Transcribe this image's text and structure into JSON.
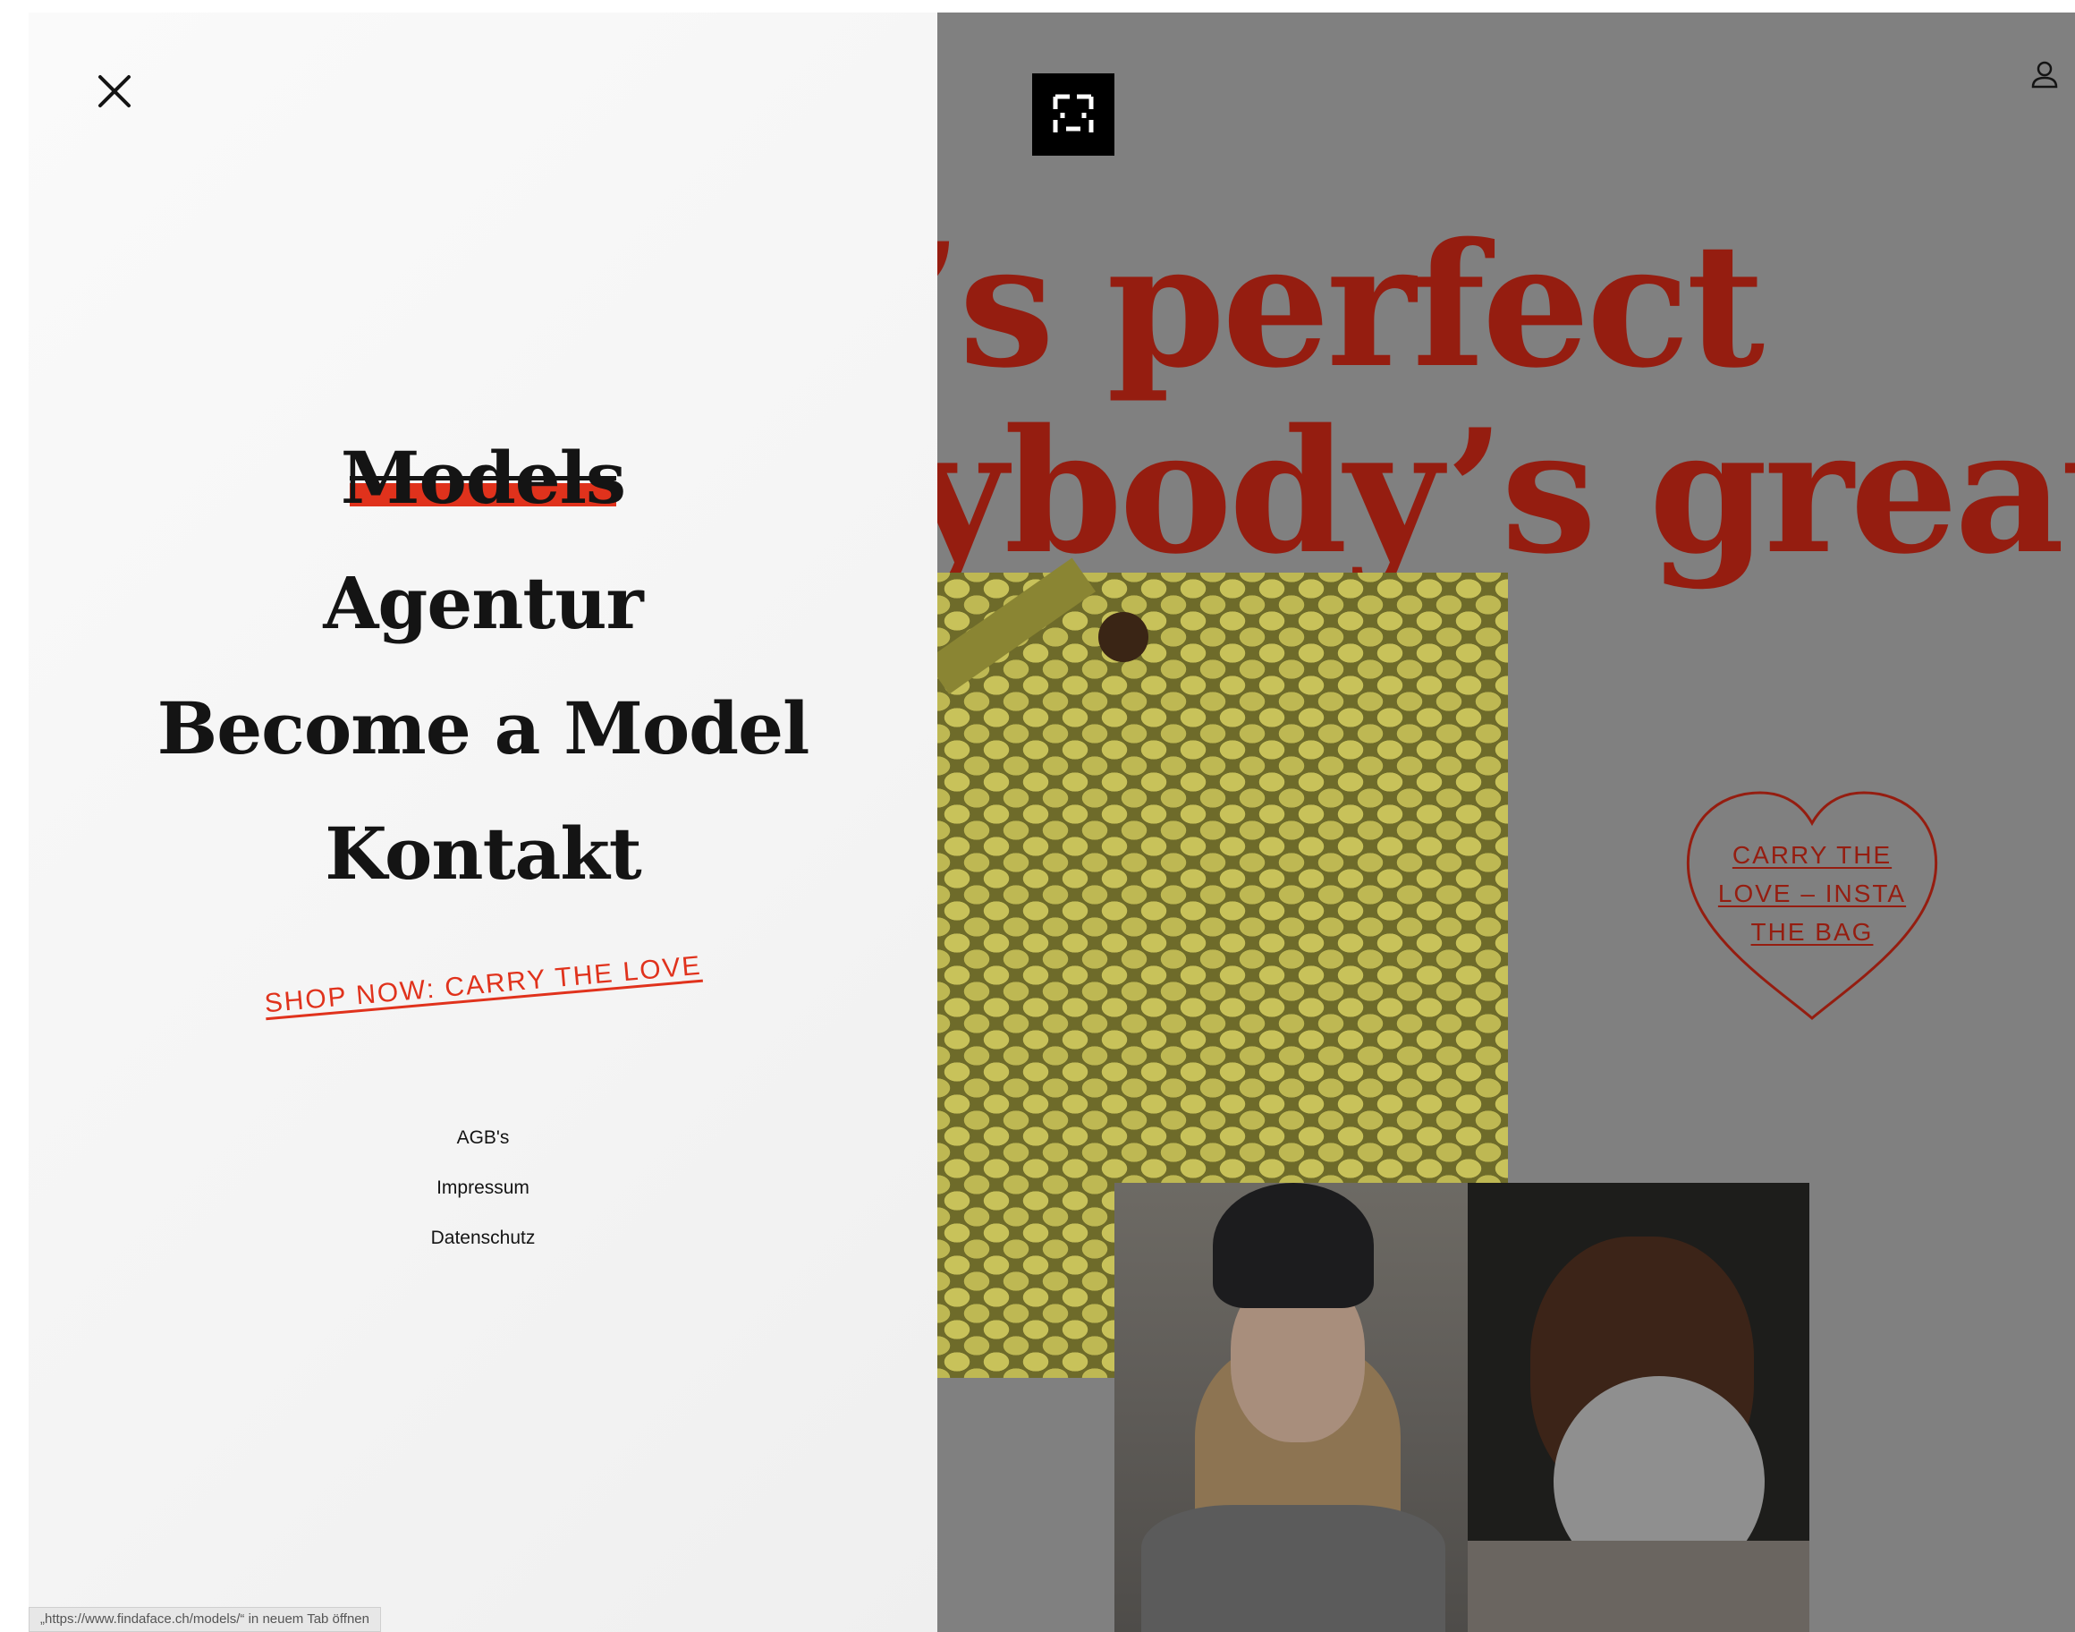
{
  "menu": {
    "items": [
      {
        "label": "Models",
        "active": true
      },
      {
        "label": "Agentur"
      },
      {
        "label": "Become a Model"
      },
      {
        "label": "Kontakt"
      }
    ],
    "shop_link": "SHOP NOW: CARRY THE LOVE",
    "legal": [
      "AGB's",
      "Impressum",
      "Datenschutz"
    ],
    "icons": {
      "close": "close-icon"
    }
  },
  "status_bar": {
    "text": "„https://www.findaface.ch/models/“ in neuem Tab öffnen"
  },
  "page": {
    "headline_line1": "’s perfect",
    "headline_line2": "ybody’s great",
    "heart_text": [
      "CARRY THE",
      "LOVE – INSTA",
      "THE BAG"
    ],
    "icons": {
      "logo": "findaface-logo-icon",
      "user": "user-icon"
    },
    "colors": {
      "accent": "#e0321c",
      "headline": "#951d10",
      "overlay": "#808080"
    }
  }
}
